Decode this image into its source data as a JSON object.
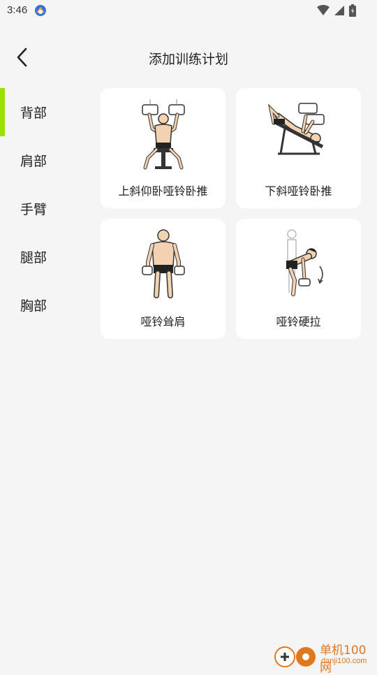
{
  "status_bar": {
    "time": "3:46",
    "icons": [
      "app-notification-icon",
      "wifi-icon",
      "signal-icon",
      "battery-icon"
    ]
  },
  "header": {
    "title": "添加训练计划",
    "back_icon": "chevron-left-icon"
  },
  "sidebar": {
    "accent_color": "#9ae000",
    "items": [
      {
        "label": "背部",
        "active": true
      },
      {
        "label": "肩部",
        "active": false
      },
      {
        "label": "手臂",
        "active": false
      },
      {
        "label": "腿部",
        "active": false
      },
      {
        "label": "胸部",
        "active": false
      }
    ]
  },
  "exercises": [
    {
      "label": "上斜仰卧哑铃卧推",
      "image": "incline-dumbbell-press-illustration"
    },
    {
      "label": "下斜哑铃卧推",
      "image": "decline-dumbbell-press-illustration"
    },
    {
      "label": "哑铃耸肩",
      "image": "dumbbell-shrug-illustration"
    },
    {
      "label": "哑铃硬拉",
      "image": "dumbbell-deadlift-illustration"
    }
  ],
  "watermark": {
    "title": "单机100网",
    "url": "danji100.com",
    "color": "#e0781e"
  }
}
